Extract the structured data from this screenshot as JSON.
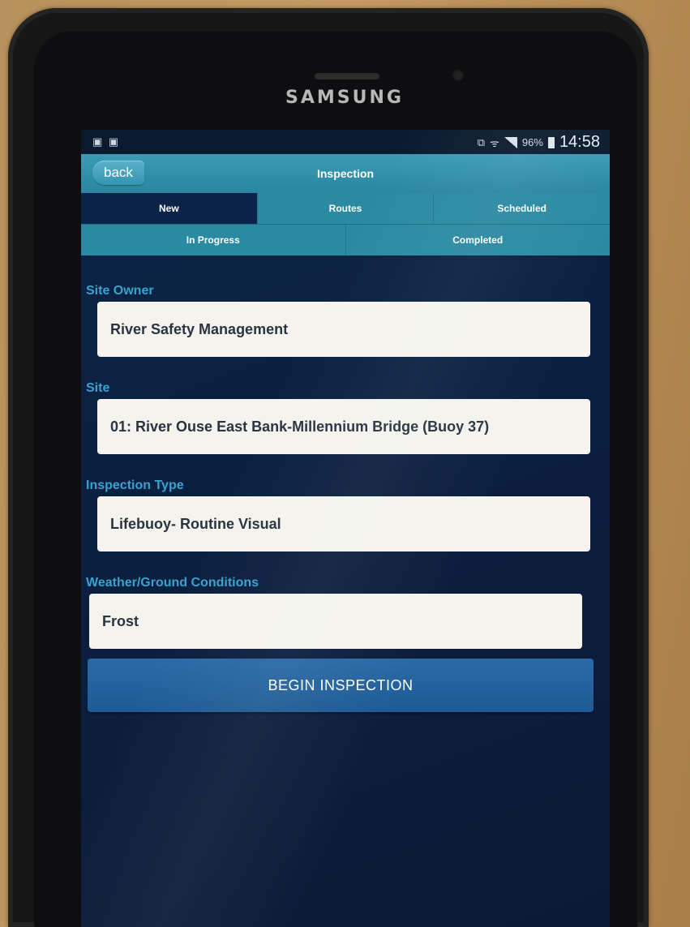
{
  "device": {
    "brand": "SAMSUNG"
  },
  "status_bar": {
    "left_icons": "image-icon, image-icon",
    "right_icons": [
      "cast-icon",
      "wifi-icon",
      "signal-icon",
      "battery-icon"
    ],
    "battery": "96%",
    "time": "14:58"
  },
  "header": {
    "back_label": "back",
    "title": "Inspection"
  },
  "tabs": {
    "row1": [
      {
        "label": "New",
        "active": true
      },
      {
        "label": "Routes",
        "active": false
      },
      {
        "label": "Scheduled",
        "active": false
      }
    ],
    "row2": [
      {
        "label": "In Progress",
        "active": false
      },
      {
        "label": "Completed",
        "active": false
      }
    ]
  },
  "form": {
    "site_owner": {
      "label": "Site Owner",
      "value": "River Safety Management"
    },
    "site": {
      "label": "Site",
      "value": "01: River Ouse East Bank-Millennium Bridge (Buoy 37)"
    },
    "inspection_type": {
      "label": "Inspection Type",
      "value": "Lifebuoy- Routine Visual"
    },
    "weather": {
      "label": "Weather/Ground Conditions",
      "value": "Frost"
    }
  },
  "actions": {
    "begin_label": "BEGIN INSPECTION"
  },
  "colors": {
    "header_teal": "#2a8aa2",
    "active_tab": "#0a2346",
    "label_blue": "#3aa2cf",
    "button_blue": "#1e5b95",
    "screen_navy": "#0b1f3f"
  }
}
